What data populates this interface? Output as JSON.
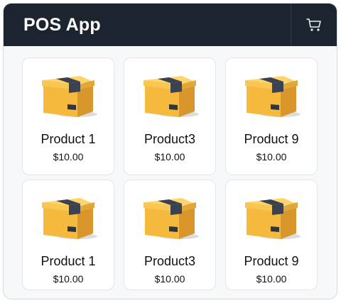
{
  "app": {
    "title": "POS App"
  },
  "header": {
    "cart_icon": "cart-icon"
  },
  "products": [
    {
      "name": "Product 1",
      "price": "$10.00",
      "icon": "box-icon"
    },
    {
      "name": "Product3",
      "price": "$10.00",
      "icon": "box-icon"
    },
    {
      "name": "Product 9",
      "price": "$10.00",
      "icon": "box-icon"
    },
    {
      "name": "Product 1",
      "price": "$10.00",
      "icon": "box-icon"
    },
    {
      "name": "Product3",
      "price": "$10.00",
      "icon": "box-icon"
    },
    {
      "name": "Product 9",
      "price": "$10.00",
      "icon": "box-icon"
    }
  ],
  "colors": {
    "header_bg": "#1c2430",
    "box_yellow": "#f5c14b",
    "tape": "#3a4150"
  }
}
